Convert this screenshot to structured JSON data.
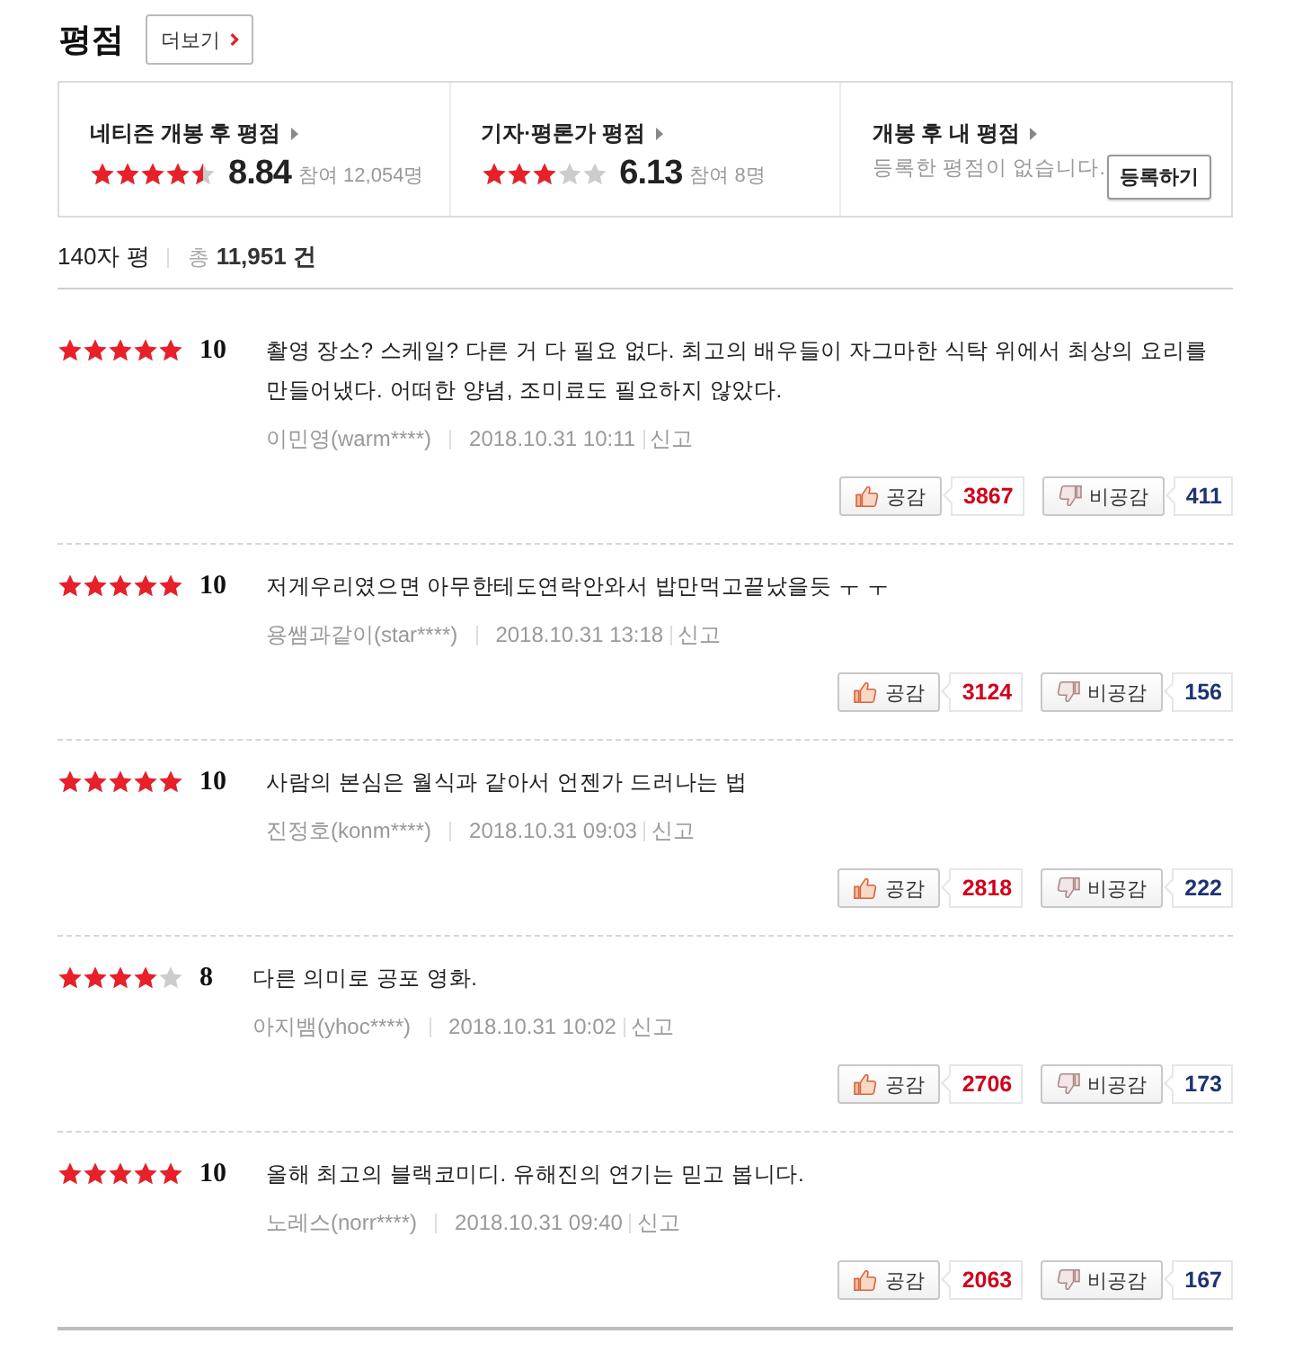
{
  "header": {
    "title": "평점",
    "more_button": "더보기"
  },
  "summary": [
    {
      "kind": "score",
      "label": "네티즌 개봉 후 평점",
      "stars": 4.5,
      "score": "8.84",
      "participants": "참여 12,054명"
    },
    {
      "kind": "score",
      "label": "기자·평론가 평점",
      "stars": 3,
      "score": "6.13",
      "participants": "참여 8명"
    },
    {
      "kind": "mine",
      "label": "개봉 후 내 평점",
      "message": "등록한 평점이 없습니다.",
      "button": "등록하기"
    }
  ],
  "review_header": {
    "title": "140자 평",
    "total_label": "총",
    "total": "11,951 건"
  },
  "reviews": [
    {
      "stars": 5,
      "score": "10",
      "text": "촬영 장소? 스케일? 다른 거 다 필요 없다. 최고의 배우들이 자그마한 식탁 위에서 최상의 요리를 만들어냈다. 어떠한 양념, 조미료도 필요하지 않았다.",
      "author": "이민영(warm****)",
      "date": "2018.10.31 10:11",
      "report": "신고",
      "like_label": "공감",
      "likes": "3867",
      "dislike_label": "비공감",
      "dislikes": "411"
    },
    {
      "stars": 5,
      "score": "10",
      "text": "저게우리였으면 아무한테도연락안와서 밥만먹고끝났을듯 ㅜ ㅜ",
      "author": "용쌤과같이(star****)",
      "date": "2018.10.31 13:18",
      "report": "신고",
      "like_label": "공감",
      "likes": "3124",
      "dislike_label": "비공감",
      "dislikes": "156"
    },
    {
      "stars": 5,
      "score": "10",
      "text": "사람의 본심은 월식과 같아서 언젠가 드러나는 법",
      "author": "진정호(konm****)",
      "date": "2018.10.31 09:03",
      "report": "신고",
      "like_label": "공감",
      "likes": "2818",
      "dislike_label": "비공감",
      "dislikes": "222"
    },
    {
      "stars": 4,
      "score": "8",
      "text": "다른 의미로 공포 영화.",
      "author": "아지뱀(yhoc****)",
      "date": "2018.10.31 10:02",
      "report": "신고",
      "like_label": "공감",
      "likes": "2706",
      "dislike_label": "비공감",
      "dislikes": "173"
    },
    {
      "stars": 5,
      "score": "10",
      "text": "올해 최고의 블랙코미디. 유해진의 연기는 믿고 봅니다.",
      "author": "노레스(norr****)",
      "date": "2018.10.31 09:40",
      "report": "신고",
      "like_label": "공감",
      "likes": "2063",
      "dislike_label": "비공감",
      "dislikes": "167"
    }
  ]
}
